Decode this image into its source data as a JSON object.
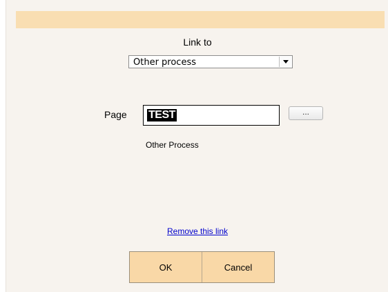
{
  "dialog": {
    "link_to_label": "Link to",
    "link_type_select": {
      "value": "Other process"
    },
    "page_label": "Page",
    "page_value": "TEST",
    "browse_button_label": "...",
    "page_caption": "Other Process",
    "remove_link_label": "Remove this link",
    "ok_label": "OK",
    "cancel_label": "Cancel"
  },
  "colors": {
    "dialog_background": "#f7f3ee",
    "header_bar": "#f9deb2",
    "button_background": "#f9d8a7",
    "link": "#0000cc"
  },
  "icons": {
    "dropdown": "chevron-down-icon"
  }
}
